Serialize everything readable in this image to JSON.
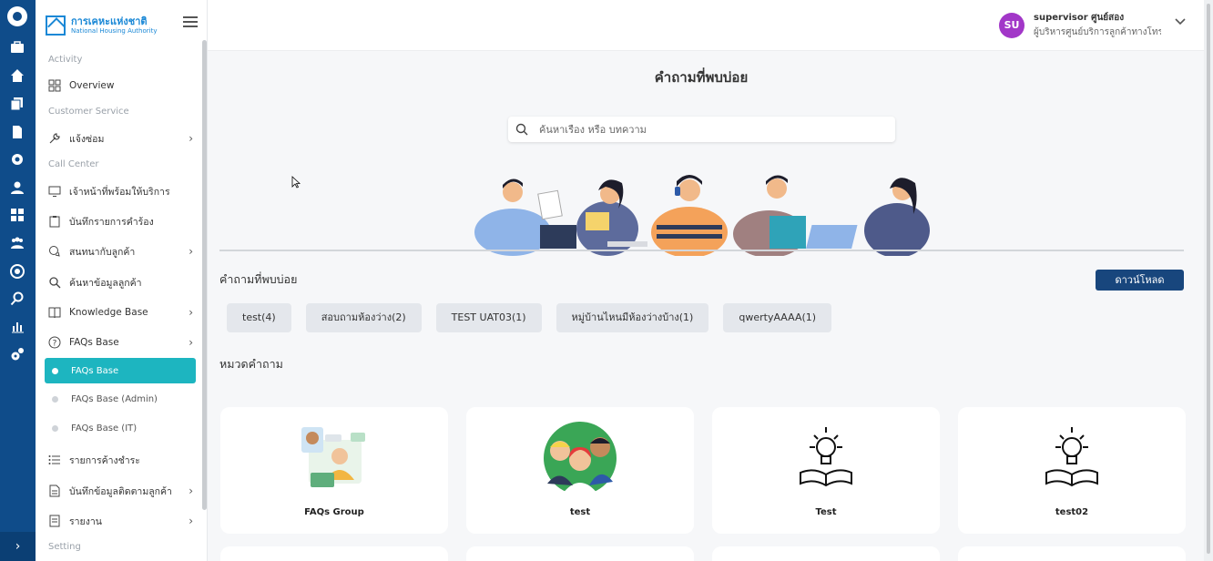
{
  "brand": {
    "name_th": "การเคหะแห่งชาติ",
    "name_en": "National Housing Authority"
  },
  "sidebar": {
    "sections": {
      "activity": "Activity",
      "customer_service": "Customer Service",
      "call_center": "Call Center",
      "setting": "Setting"
    },
    "items": {
      "overview": "Overview",
      "repair": "แจ้งซ่อม",
      "agent_ready": "เจ้าหน้าที่พร้อมให้บริการ",
      "request_log": "บันทึกรายการคำร้อง",
      "chat": "สนทนากับลูกค้า",
      "customer_search": "ค้นหาข้อมูลลูกค้า",
      "knowledge_base": "Knowledge Base",
      "faqs_base": "FAQs Base",
      "outstanding": "รายการค้างชำระ",
      "followup": "บันทึกข้อมูลติดตามลูกค้า",
      "report": "รายงาน"
    },
    "sub_items": {
      "faqs_base": "FAQs Base",
      "faqs_admin": "FAQs Base (Admin)",
      "faqs_it": "FAQs Base (IT)"
    }
  },
  "user": {
    "initials": "SU",
    "name": "supervisor ศูนย์สอง",
    "role": "ผู้บริหารศูนย์บริการลูกค้าทางโทรศัพท์"
  },
  "main": {
    "title": "คำถามที่พบบ่อย",
    "search_placeholder": "ค้นหาเรื่อง หรือ บทความ",
    "faq_heading": "คำถามที่พบบ่อย",
    "download_label": "ดาวน์โหลด",
    "chips": [
      "test(4)",
      "สอบถามห้องว่าง(2)",
      "TEST UAT03(1)",
      "หมู่บ้านไหนมีห้องว่างบ้าง(1)",
      "qwertyAAAA(1)"
    ],
    "category_heading": "หมวดคำถาม",
    "categories": [
      "FAQs Group",
      "test",
      "Test",
      "test02"
    ]
  }
}
